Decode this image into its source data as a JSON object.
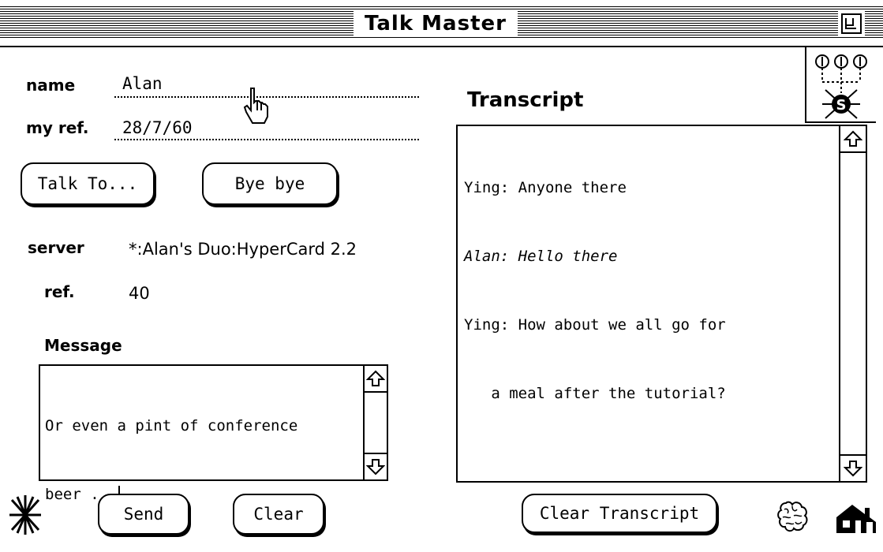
{
  "window": {
    "title": "Talk Master"
  },
  "form": {
    "name_label": "name",
    "name_value": "Alan",
    "ref_label": "my ref.",
    "ref_value": "28/7/60"
  },
  "buttons": {
    "talk_to": "Talk To...",
    "bye_bye": "Bye bye",
    "send": "Send",
    "clear": "Clear",
    "clear_transcript": "Clear Transcript"
  },
  "server": {
    "label": "server",
    "value": "*:Alan's Duo:HyperCard 2.2",
    "ref_label": "ref.",
    "ref_value": "40"
  },
  "message": {
    "label": "Message",
    "lines": [
      "Or even a pint of conference",
      "beer ..."
    ]
  },
  "transcript": {
    "label": "Transcript",
    "lines": [
      {
        "text": "Ying: Anyone there",
        "style": "normal"
      },
      {
        "text": "Alan: Hello there",
        "style": "italic"
      },
      {
        "text": "Ying: How about we all go for",
        "style": "normal"
      },
      {
        "text": "   a meal after the tutorial?",
        "style": "normal"
      }
    ]
  },
  "icons": {
    "server_status": "server-network-icon",
    "disconnect": "starburst-icon",
    "brain": "brain-icon",
    "home": "home-icon",
    "pointer": "hand-pointer-icon"
  }
}
